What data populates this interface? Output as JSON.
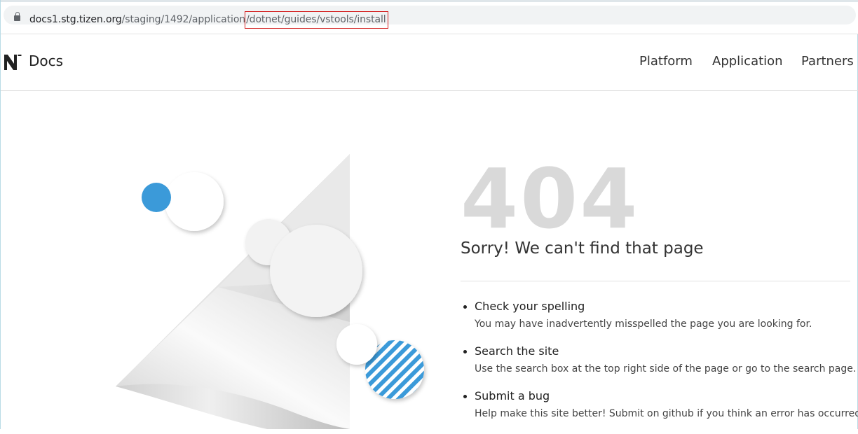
{
  "browser": {
    "url_host": "docs1.stg.tizen.org",
    "url_path": "/staging/1492/application",
    "url_highlighted": "/dotnet/guides/vstools/install"
  },
  "header": {
    "brand": "Docs",
    "menu": [
      "Platform",
      "Application",
      "Partners"
    ]
  },
  "error": {
    "code": "404",
    "message": "Sorry! We can't find that page",
    "tips": [
      {
        "title": "Check your spelling",
        "desc": "You may have inadvertently misspelled the page you are looking for."
      },
      {
        "title": "Search the site",
        "desc": "Use the search box at the top right side of the page or go to the search page."
      },
      {
        "title": "Submit a bug",
        "desc": "Help make this site better! Submit on github if you think an error has occurred."
      }
    ]
  },
  "colors": {
    "accent_blue": "#3b9ad9",
    "code_gray": "#d9d9d9"
  }
}
